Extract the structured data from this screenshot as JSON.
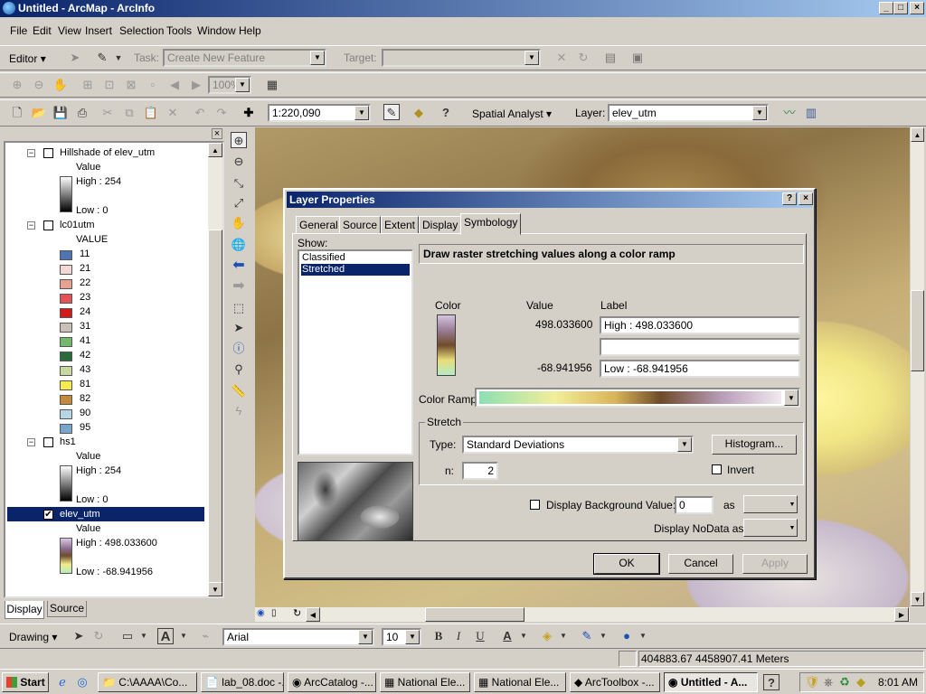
{
  "window": {
    "title": "Untitled - ArcMap - ArcInfo",
    "minimize": "_",
    "maximize": "□",
    "close": "×"
  },
  "menu": [
    "File",
    "Edit",
    "View",
    "Insert",
    "Selection",
    "Tools",
    "Window",
    "Help"
  ],
  "editor_toolbar": {
    "editor": "Editor",
    "task_label": "Task:",
    "task_value": "Create New Feature",
    "target_label": "Target:",
    "target_value": ""
  },
  "zoom_combo": "100%",
  "standard_toolbar": {
    "scale": "1:220,090",
    "spatial_analyst": "Spatial Analyst",
    "layer_label": "Layer:",
    "layer_value": "elev_utm"
  },
  "toc": {
    "tabs": [
      "Display",
      "Source"
    ],
    "layers": [
      {
        "name": "Hillshade of elev_utm",
        "header": "Value",
        "high": "High : 254",
        "low": "Low : 0"
      },
      {
        "name": "lc01utm",
        "header": "VALUE",
        "classes": [
          {
            "label": "11",
            "color": "#4f74b3"
          },
          {
            "label": "21",
            "color": "#f4d8d4"
          },
          {
            "label": "22",
            "color": "#e8a090"
          },
          {
            "label": "23",
            "color": "#e25456"
          },
          {
            "label": "24",
            "color": "#d11a1a"
          },
          {
            "label": "31",
            "color": "#c7c1b8"
          },
          {
            "label": "41",
            "color": "#73b96c"
          },
          {
            "label": "42",
            "color": "#2a6a3b"
          },
          {
            "label": "43",
            "color": "#c6d9a0"
          },
          {
            "label": "81",
            "color": "#f5eb4e"
          },
          {
            "label": "82",
            "color": "#c28a3a"
          },
          {
            "label": "90",
            "color": "#b6d6e6"
          },
          {
            "label": "95",
            "color": "#7aa6cc"
          }
        ]
      },
      {
        "name": "hs1",
        "header": "Value",
        "high": "High : 254",
        "low": "Low : 0"
      },
      {
        "name": "elev_utm",
        "header": "Value",
        "high": "High : 498.033600",
        "low": "Low : -68.941956"
      }
    ]
  },
  "dialog": {
    "title": "Layer Properties",
    "help": "?",
    "close": "×",
    "tabs": [
      "General",
      "Source",
      "Extent",
      "Display",
      "Symbology"
    ],
    "active_tab": "Symbology",
    "show_label": "Show:",
    "show_items": [
      "Classified",
      "Stretched"
    ],
    "selected_show": "Stretched",
    "description": "Draw raster stretching values along a color ramp",
    "col_color": "Color",
    "col_value": "Value",
    "col_label": "Label",
    "high_value": "498.033600",
    "high_label": "High : 498.033600",
    "mid_label": "",
    "low_value": "-68.941956",
    "low_label": "Low : -68.941956",
    "color_ramp_label": "Color Ramp:",
    "stretch_group": "Stretch",
    "type_label": "Type:",
    "type_value": "Standard Deviations",
    "histogram_button": "Histogram...",
    "n_label": "n:",
    "n_value": "2",
    "invert_label": "Invert",
    "bg_label": "Display Background Value:",
    "bg_value": "0",
    "as_label": "as",
    "nodata_label": "Display NoData as",
    "ok": "OK",
    "cancel": "Cancel",
    "apply": "Apply"
  },
  "drawing_toolbar": {
    "drawing": "Drawing",
    "font": "Arial",
    "size": "10",
    "bold": "B",
    "italic": "I",
    "underline": "U",
    "font_color_glyph": "A"
  },
  "statusbar": {
    "coords": "404883.67  4458907.41 Meters"
  },
  "taskbar": {
    "start": "Start",
    "items": [
      {
        "label": "C:\\AAAA\\Co...",
        "active": false
      },
      {
        "label": "lab_08.doc -...",
        "active": false
      },
      {
        "label": "ArcCatalog -...",
        "active": false
      },
      {
        "label": "National Ele...",
        "active": false
      },
      {
        "label": "National Ele...",
        "active": false
      },
      {
        "label": "ArcToolbox -...",
        "active": false
      },
      {
        "label": "Untitled - A...",
        "active": true
      }
    ],
    "help": "?",
    "clock": "8:01 AM"
  }
}
